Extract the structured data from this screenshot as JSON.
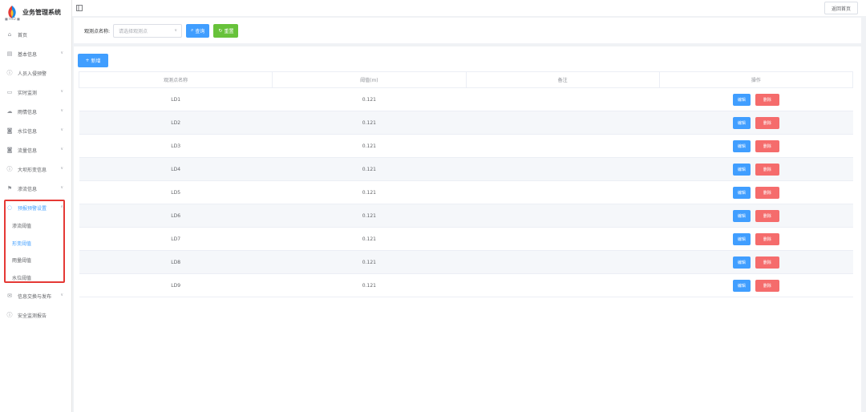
{
  "app": {
    "title": "业务管理系统",
    "logo_sub": "■ HSD ■"
  },
  "sidebar": {
    "items": [
      {
        "label": "首页",
        "icon": "home-icon",
        "chevron": false
      },
      {
        "label": "基本信息",
        "icon": "document-icon",
        "chevron": true
      },
      {
        "label": "人员入侵预警",
        "icon": "info-circle-icon",
        "chevron": false
      },
      {
        "label": "实时监测",
        "icon": "monitor-icon",
        "chevron": true
      },
      {
        "label": "雨情信息",
        "icon": "cloud-icon",
        "chevron": true
      },
      {
        "label": "水位信息",
        "icon": "gauge-icon",
        "chevron": true
      },
      {
        "label": "流量信息",
        "icon": "gauge-icon",
        "chevron": true
      },
      {
        "label": "大坝形变信息",
        "icon": "info-circle-icon",
        "chevron": true
      },
      {
        "label": "渗流信息",
        "icon": "flag-icon",
        "chevron": true
      },
      {
        "label": "预报预警设置",
        "icon": "chat-icon",
        "chevron": true,
        "active": true
      }
    ],
    "sub_items": [
      {
        "label": "渗流阈值",
        "active": false
      },
      {
        "label": "形变阈值",
        "active": true
      },
      {
        "label": "雨量阈值",
        "active": false
      },
      {
        "label": "水位阈值",
        "active": false
      }
    ],
    "bottom_items": [
      {
        "label": "信息交换与发布",
        "icon": "mail-icon",
        "chevron": true
      },
      {
        "label": "安全监测报告",
        "icon": "info-circle-icon",
        "chevron": false
      }
    ]
  },
  "topbar": {
    "home_button": "返回首页"
  },
  "search": {
    "label": "观测点名称:",
    "select_placeholder": "请选择观测点",
    "query_button": "查询",
    "reset_button": "重置"
  },
  "actions": {
    "add_button": "新增"
  },
  "table": {
    "columns": [
      "观测点名称",
      "阈值(m)",
      "备注",
      "操作"
    ],
    "edit_label": "编辑",
    "delete_label": "删除",
    "rows": [
      {
        "name": "LD1",
        "threshold": "0.121",
        "remark": ""
      },
      {
        "name": "LD2",
        "threshold": "0.121",
        "remark": ""
      },
      {
        "name": "LD3",
        "threshold": "0.121",
        "remark": ""
      },
      {
        "name": "LD4",
        "threshold": "0.121",
        "remark": ""
      },
      {
        "name": "LD5",
        "threshold": "0.121",
        "remark": ""
      },
      {
        "name": "LD6",
        "threshold": "0.121",
        "remark": ""
      },
      {
        "name": "LD7",
        "threshold": "0.121",
        "remark": ""
      },
      {
        "name": "LD8",
        "threshold": "0.121",
        "remark": ""
      },
      {
        "name": "LD9",
        "threshold": "0.121",
        "remark": ""
      }
    ]
  },
  "colors": {
    "primary": "#409eff",
    "success": "#67c23a",
    "danger": "#f56c6c",
    "highlight": "#e53935"
  }
}
